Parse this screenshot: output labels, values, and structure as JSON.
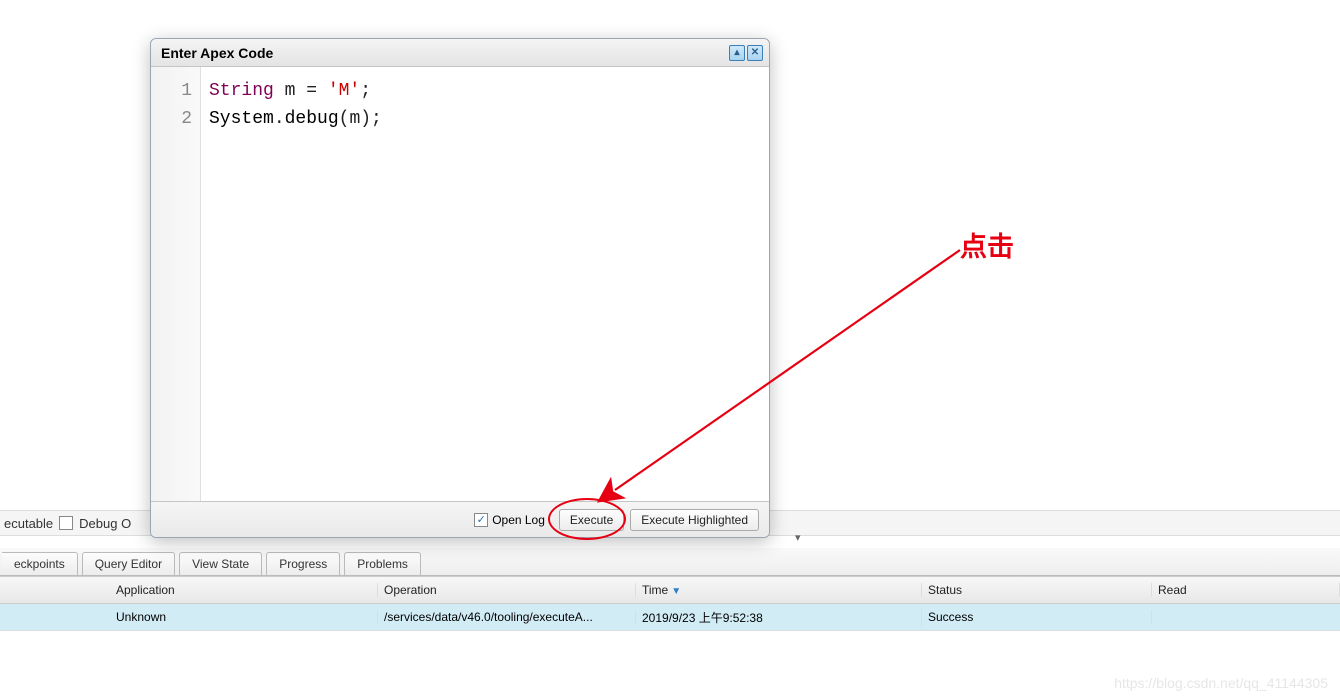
{
  "dialog": {
    "title": "Enter Apex Code",
    "code": {
      "line1_keyword": "String",
      "line1_rest": " m = ",
      "line1_string": "'M'",
      "line1_end": ";",
      "line2_sys": "System",
      "line2_dot": ".",
      "line2_fn": "debug",
      "line2_arg": "(m)",
      "line2_end": ";",
      "gutter1": "1",
      "gutter2": "2"
    },
    "open_log_label": "Open Log",
    "execute_label": "Execute",
    "execute_highlighted_label": "Execute Highlighted"
  },
  "toolbar": {
    "executable": "ecutable",
    "debug_only": "Debug O"
  },
  "tabs": {
    "checkpoints": "eckpoints",
    "query_editor": "Query Editor",
    "view_state": "View State",
    "progress": "Progress",
    "problems": "Problems"
  },
  "grid": {
    "headers": {
      "col0": "",
      "application": "Application",
      "operation": "Operation",
      "time": "Time",
      "status": "Status",
      "read": "Read"
    },
    "row": {
      "application": "Unknown",
      "operation": "/services/data/v46.0/tooling/executeA...",
      "time": "2019/9/23 上午9:52:38",
      "status": "Success",
      "read": ""
    }
  },
  "annotation": {
    "click_label": "点击"
  },
  "watermark": "https://blog.csdn.net/qq_41144305"
}
